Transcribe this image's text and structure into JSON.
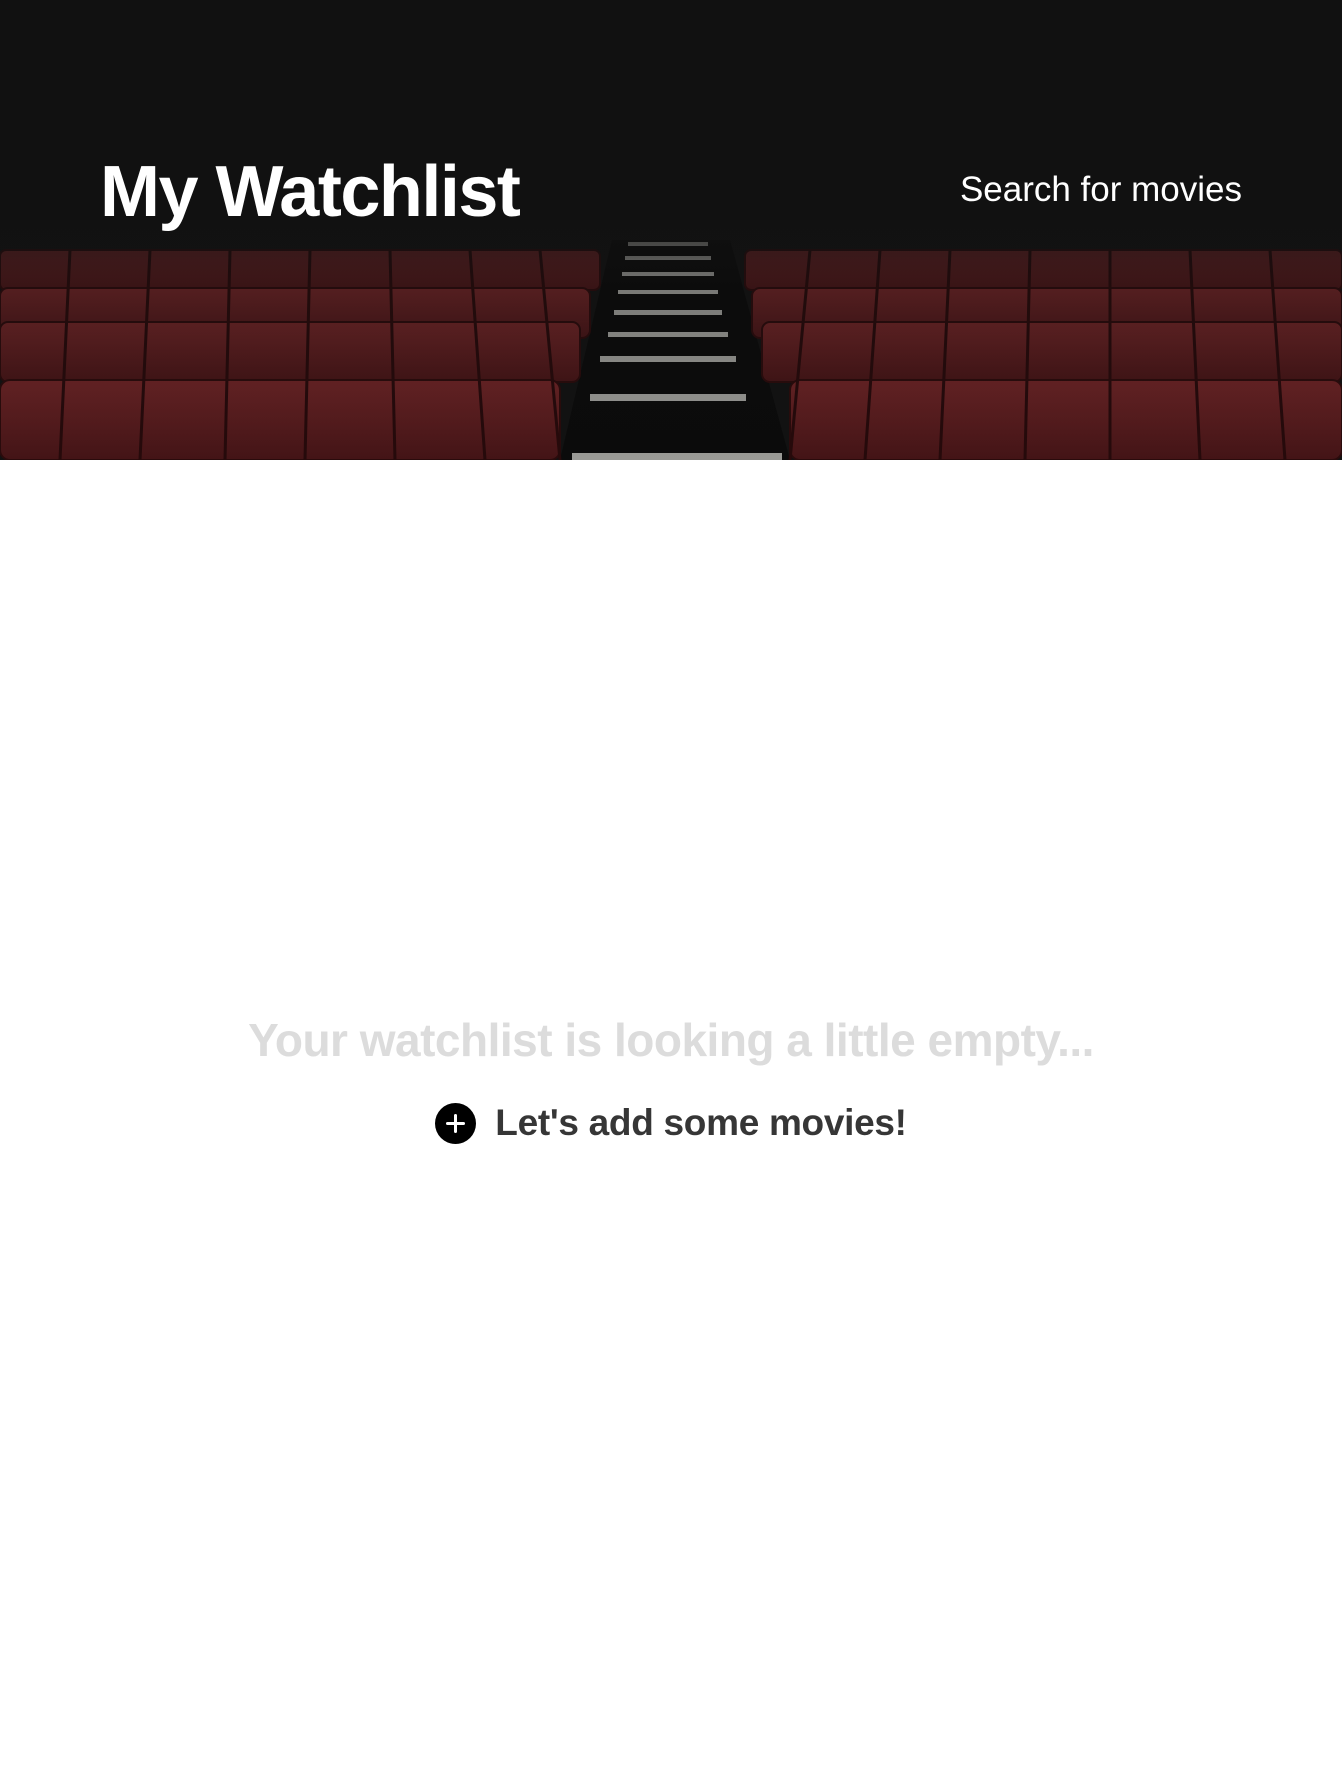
{
  "header": {
    "title": "My Watchlist",
    "search_link": "Search for movies",
    "background_image": "cinema-seats-image"
  },
  "main": {
    "empty_message": "Your watchlist is looking a little empty...",
    "add_action": {
      "label": "Let's add some movies!",
      "icon": "plus-circle-icon"
    }
  },
  "colors": {
    "header_dark": "#121212",
    "seat_red": "#5a1c1e",
    "title_white": "#ffffff",
    "empty_text": "#dcdcdc",
    "action_text": "#363636",
    "icon_black": "#000000"
  }
}
